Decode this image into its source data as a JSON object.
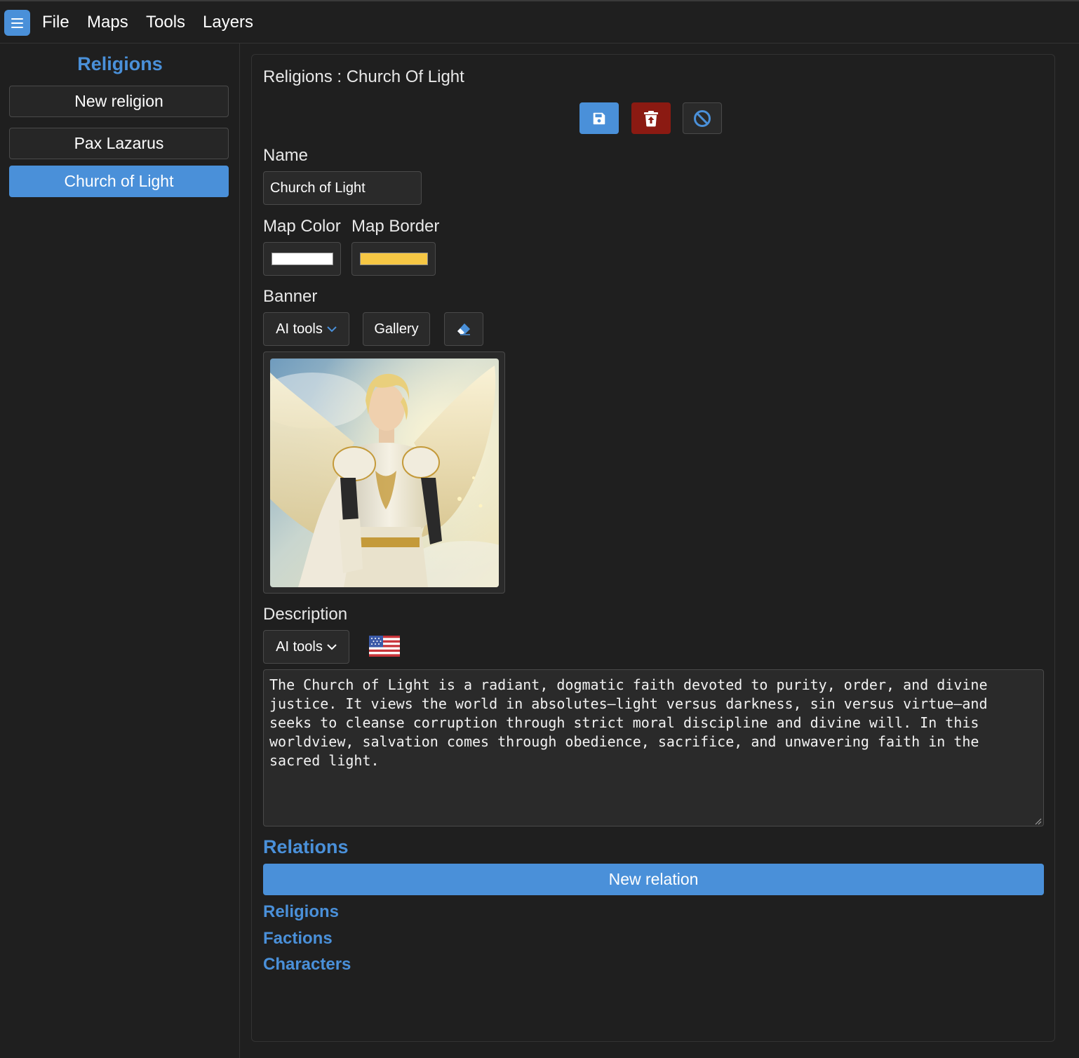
{
  "menubar": {
    "items": [
      "File",
      "Maps",
      "Tools",
      "Layers"
    ]
  },
  "sidebar": {
    "title": "Religions",
    "new_button": "New religion",
    "items": [
      {
        "label": "Pax Lazarus",
        "active": false
      },
      {
        "label": "Church of Light",
        "active": true
      }
    ]
  },
  "editor": {
    "title": "Religions : Church Of Light",
    "name_label": "Name",
    "name_value": "Church of Light",
    "map_color_label": "Map Color",
    "map_border_label": "Map Border",
    "map_color": "#ffffff",
    "map_border_color": "#f6c744",
    "banner_label": "Banner",
    "ai_tools_label": "AI tools",
    "gallery_label": "Gallery",
    "description_label": "Description",
    "description_ai_tools_label": "AI tools",
    "description_text": "The Church of Light is a radiant, dogmatic faith devoted to purity, order, and divine justice. It views the world in absolutes—light versus darkness, sin versus virtue—and seeks to cleanse corruption through strict moral discipline and divine will. In this worldview, salvation comes through obedience, sacrifice, and unwavering faith in the sacred light.",
    "language_icon": "us-flag-icon"
  },
  "relations": {
    "title": "Relations",
    "new_button": "New relation",
    "groups": [
      "Religions",
      "Factions",
      "Characters"
    ]
  },
  "colors": {
    "accent": "#4a90d9",
    "danger": "#8b1a12",
    "background": "#1f1f1f"
  }
}
